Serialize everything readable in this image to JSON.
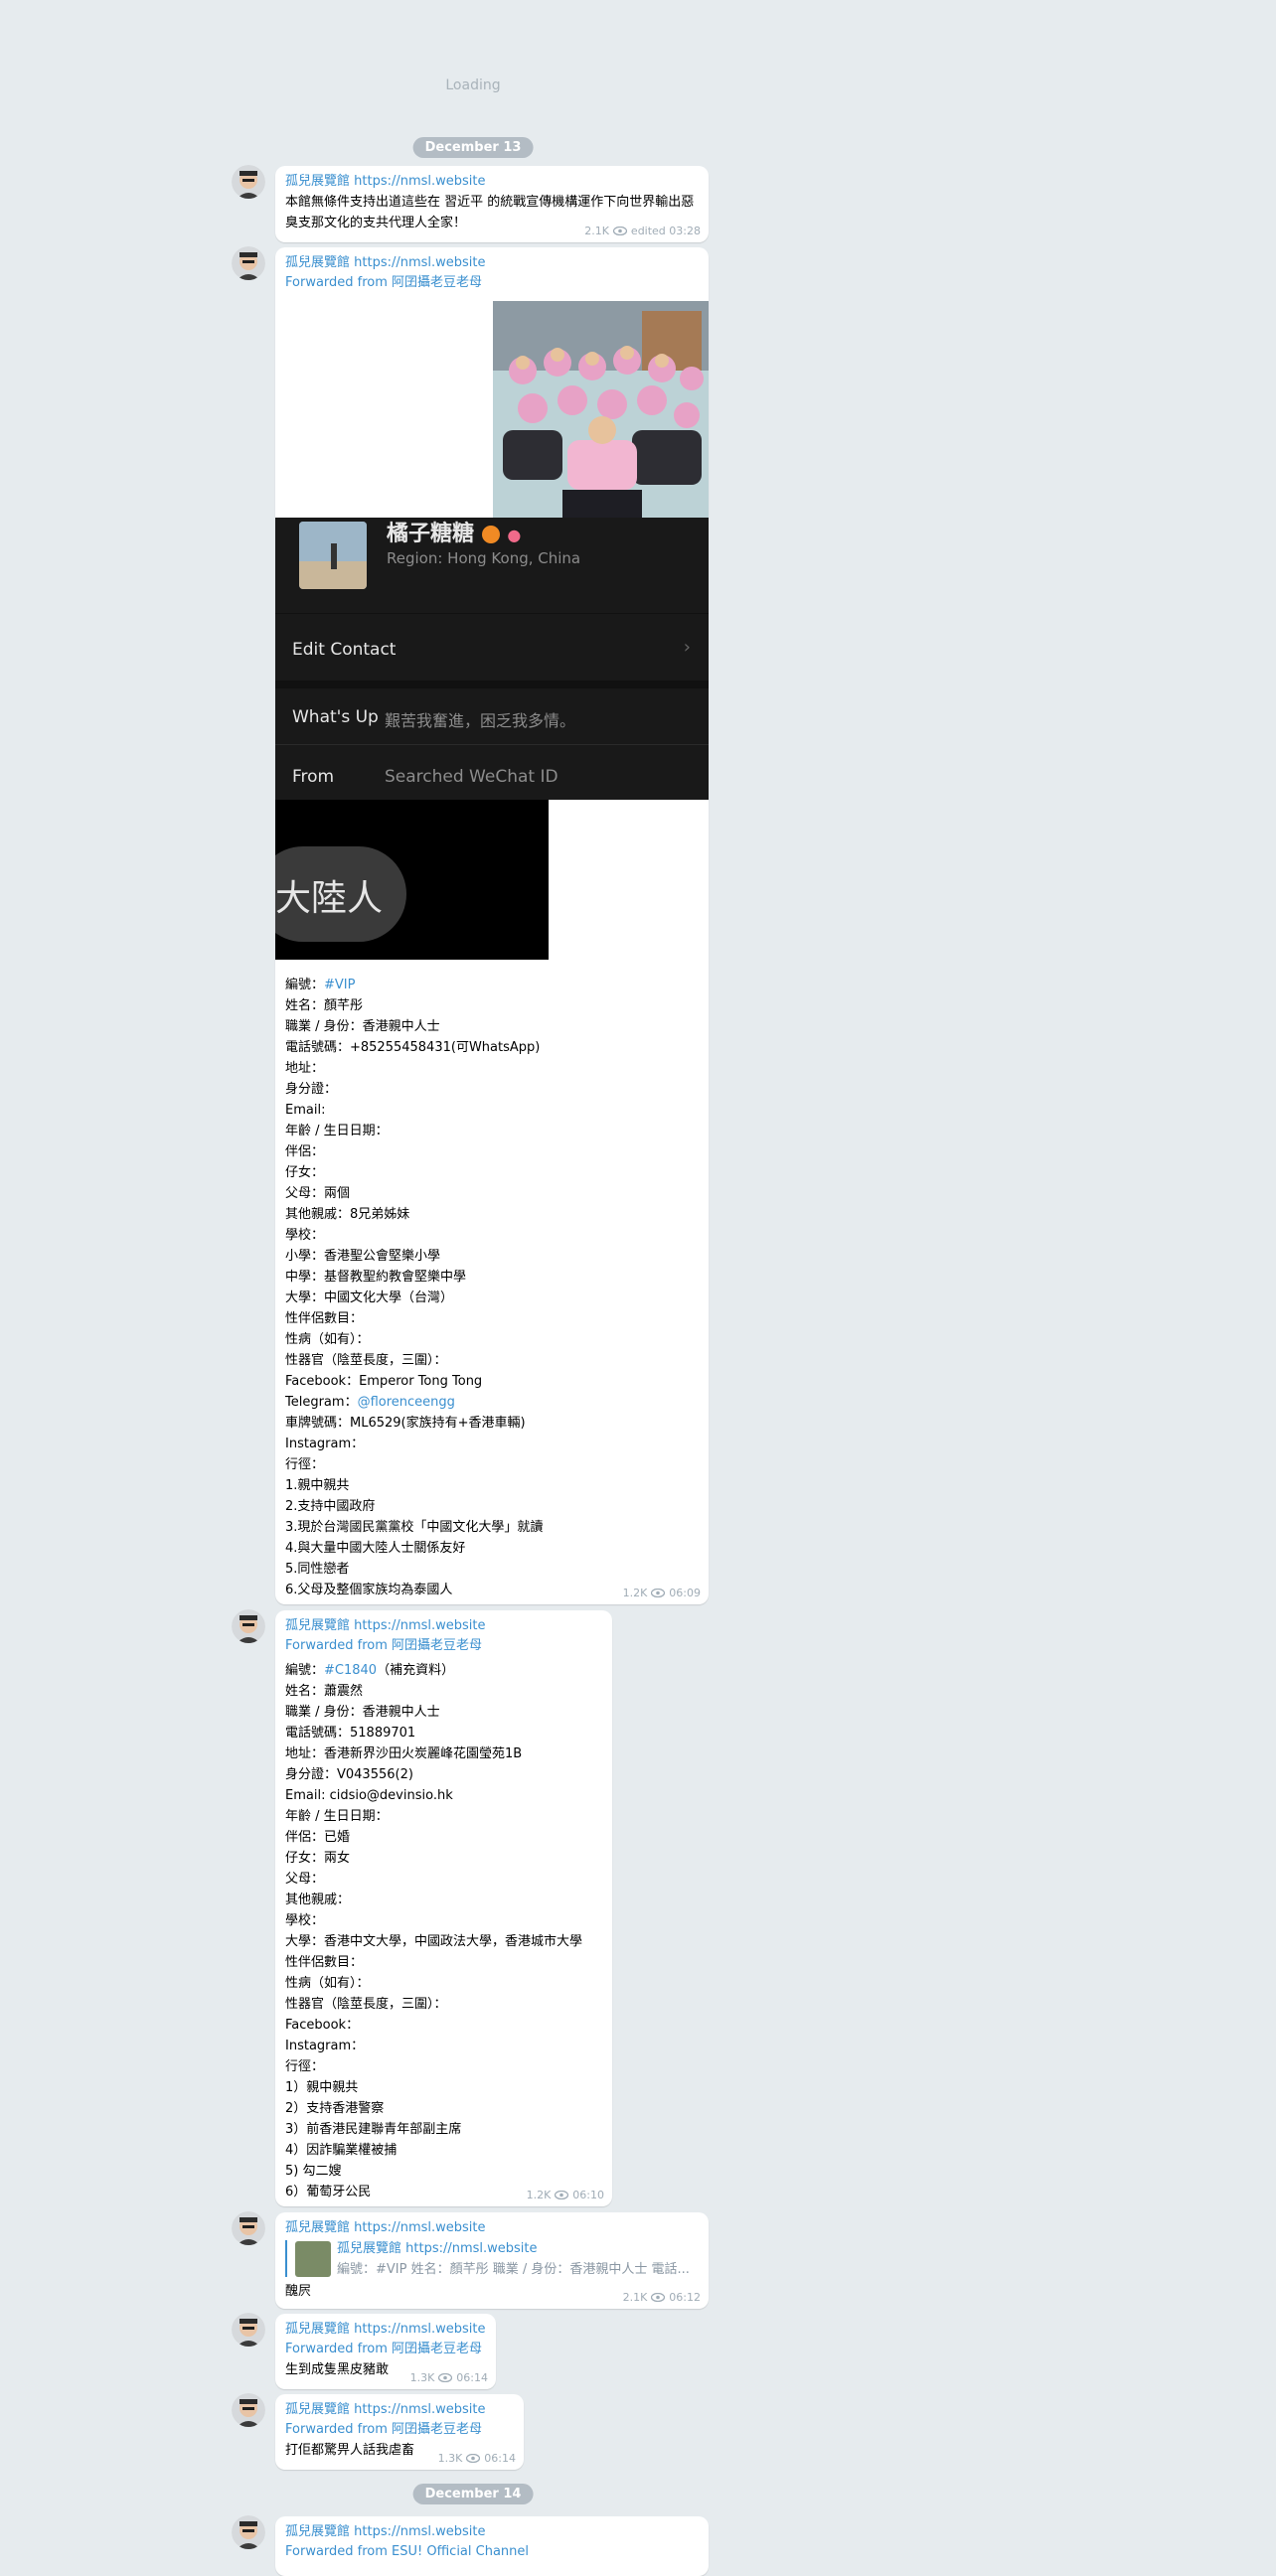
{
  "loading": "Loading",
  "dates": [
    "December 13",
    "December 14"
  ],
  "sender_name": "孤兒展覽館 https://nmsl.website",
  "messages": [
    {
      "text": "本館無條件支持出道這些在 習近平 的統戰宣傳機構運作下向世界輸出惡臭支那文化的支共代理人全家！",
      "views": "2.1K",
      "time": "edited 03:28"
    },
    {
      "forwarded_from": "Forwarded from 阿囝攝老豆老母",
      "wechat_card": {
        "name": "橘子糖糖",
        "region": "Region: Hong Kong, China",
        "edit_contact": "Edit Contact",
        "whats_up_label": "What's Up",
        "whats_up_value": "艱苦我奮進，困乏我多情。",
        "from_label": "From",
        "from_value": "Searched WeChat ID",
        "tag_text": "大陸人"
      },
      "lines": [
        {
          "pre": "編號：",
          "link": "#VIP",
          "post": ""
        },
        {
          "pre": "姓名：顏芊彤"
        },
        {
          "pre": "職業 / 身份：香港親中人士"
        },
        {
          "pre": "電話號碼：+85255458431(可WhatsApp)"
        },
        {
          "pre": "地址："
        },
        {
          "pre": "身分證："
        },
        {
          "pre": "Email:"
        },
        {
          "pre": "年齡 / 生日日期："
        },
        {
          "pre": "伴侶："
        },
        {
          "pre": "仔女："
        },
        {
          "pre": "父母：兩個"
        },
        {
          "pre": "其他親戚：8兄弟姊妹"
        },
        {
          "pre": "學校："
        },
        {
          "pre": "小學：香港聖公會堅樂小學"
        },
        {
          "pre": "中學：基督教聖約教會堅樂中學"
        },
        {
          "pre": "大學：中國文化大學（台灣）"
        },
        {
          "pre": "性伴侶數目："
        },
        {
          "pre": "性病（如有）："
        },
        {
          "pre": "性器官（陰莖長度，三圍）："
        },
        {
          "pre": "Facebook：Emperor Tong Tong"
        },
        {
          "pre": "Telegram：",
          "link": "@florenceengg",
          "post": ""
        },
        {
          "pre": "車牌號碼：ML6529(家族持有+香港車輛)"
        },
        {
          "pre": "Instagram："
        },
        {
          "pre": "行徑："
        },
        {
          "pre": "1.親中親共"
        },
        {
          "pre": "2.支持中國政府"
        },
        {
          "pre": "3.現於台灣國民黨黨校「中國文化大學」就讀"
        },
        {
          "pre": "4.與大量中國大陸人士關係友好"
        },
        {
          "pre": "5.同性戀者"
        },
        {
          "pre": "6.父母及整個家族均為泰國人"
        }
      ],
      "views": "1.2K",
      "time": "06:09"
    },
    {
      "forwarded_from": "Forwarded from 阿囝攝老豆老母",
      "lines": [
        {
          "pre": "編號：",
          "link": "#C1840",
          "post": "（補充資料）"
        },
        {
          "pre": "姓名：蕭震然"
        },
        {
          "pre": "職業 / 身份：香港親中人士"
        },
        {
          "pre": "電話號碼：51889701"
        },
        {
          "pre": "地址：香港新界沙田火炭麗峰花園瑩苑1B"
        },
        {
          "pre": "身分證：V043556(2)"
        },
        {
          "pre": "Email: cidsio@devinsio.hk"
        },
        {
          "pre": "年齡 / 生日日期："
        },
        {
          "pre": "伴侶：已婚"
        },
        {
          "pre": "仔女：兩女"
        },
        {
          "pre": "父母："
        },
        {
          "pre": "其他親戚："
        },
        {
          "pre": "學校："
        },
        {
          "pre": "大學：香港中文大學，中國政法大學，香港城市大學"
        },
        {
          "pre": "性伴侶數目："
        },
        {
          "pre": "性病（如有）："
        },
        {
          "pre": "性器官（陰莖長度，三圍）："
        },
        {
          "pre": "Facebook："
        },
        {
          "pre": "Instagram："
        },
        {
          "pre": "行徑："
        },
        {
          "pre": "1）親中親共"
        },
        {
          "pre": "2）支持香港警察"
        },
        {
          "pre": "3）前香港民建聯青年部副主席"
        },
        {
          "pre": "4）因詐騙業權被捕"
        },
        {
          "pre": "5) 勾二嫂"
        },
        {
          "pre": "6）葡萄牙公民"
        }
      ],
      "views": "1.2K",
      "time": "06:10"
    },
    {
      "reply_sender": "孤兒展覽館 https://nmsl.website",
      "reply_text": "編號：#VIP 姓名：顏芊彤 職業 / 身份：香港親中人士 電話...",
      "text": "醜屄",
      "views": "2.1K",
      "time": "06:12"
    },
    {
      "forwarded_from": "Forwarded from 阿囝攝老豆老母",
      "text": "生到成隻黑皮豬敢",
      "views": "1.3K",
      "time": "06:14"
    },
    {
      "forwarded_from": "Forwarded from 阿囝攝老豆老母",
      "text": "打佢都驚畀人話我虐畜",
      "views": "1.3K",
      "time": "06:14"
    },
    {
      "forwarded_from": "Forwarded from ESU! Official Channel"
    }
  ]
}
